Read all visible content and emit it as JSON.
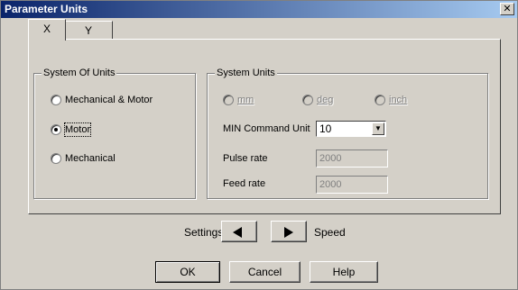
{
  "dialog": {
    "title": "Parameter Units",
    "close_glyph": "✕",
    "close_icon": "close-icon"
  },
  "tabs": [
    {
      "label": "X",
      "selected": true
    },
    {
      "label": "Y",
      "selected": false
    }
  ],
  "system_of_units": {
    "label": "System Of Units",
    "options": [
      {
        "label": "Mechanical & Motor",
        "checked": false
      },
      {
        "label": "Motor",
        "checked": true
      },
      {
        "label": "Mechanical",
        "checked": false
      }
    ]
  },
  "system_units": {
    "label": "System Units",
    "units": [
      {
        "label": "mm",
        "checked": false,
        "enabled": false
      },
      {
        "label": "deg",
        "checked": false,
        "enabled": false
      },
      {
        "label": "inch",
        "checked": false,
        "enabled": false
      }
    ],
    "min_command_unit": {
      "label": "MIN Command Unit",
      "value": "10",
      "arrow_icon": "dropdown-arrow-icon"
    },
    "pulse_rate": {
      "label": "Pulse rate",
      "value": "2000"
    },
    "feed_rate": {
      "label": "Feed rate",
      "value": "2000"
    }
  },
  "settings_nav": {
    "left_label": "Settings",
    "right_label": "Speed"
  },
  "buttons": {
    "ok": "OK",
    "cancel": "Cancel",
    "help": "Help"
  },
  "colors": {
    "face": "#d4d0c8",
    "title_start": "#0a246a",
    "title_end": "#a6caf0",
    "disabled_text": "#808080"
  }
}
